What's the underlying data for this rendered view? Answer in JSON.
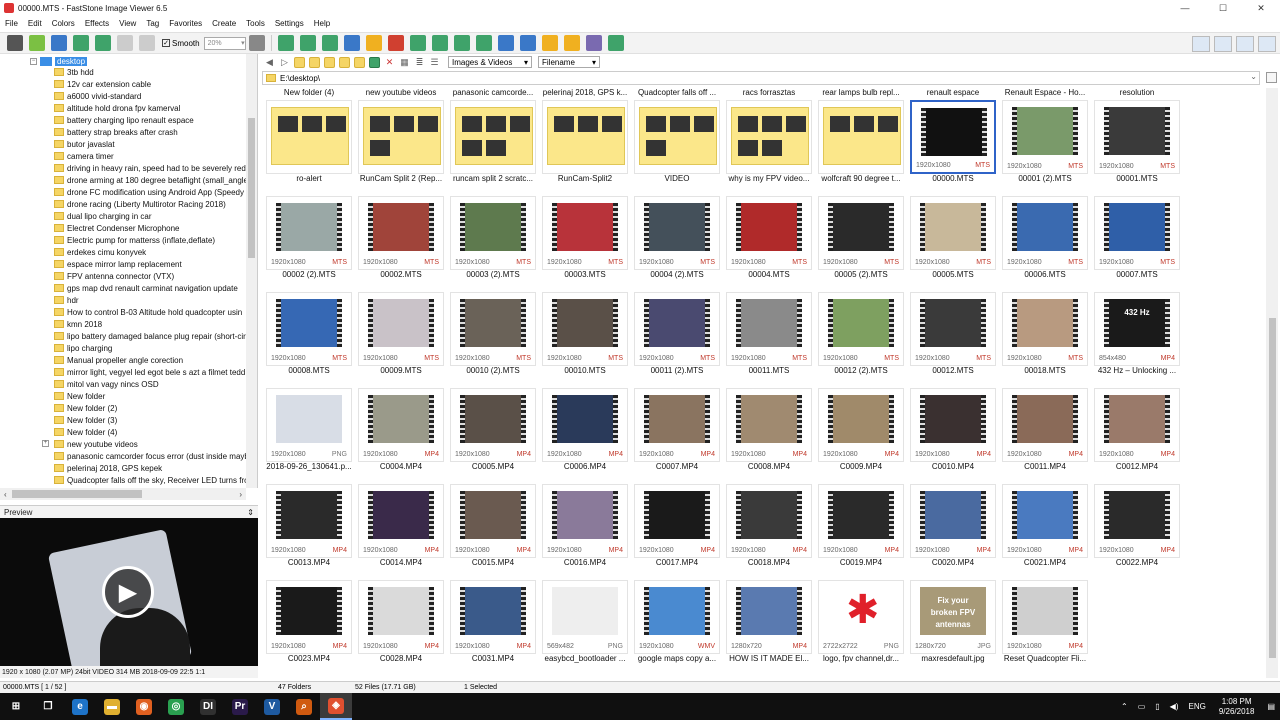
{
  "window": {
    "title": "00000.MTS - FastStone Image Viewer 6.5",
    "controls": [
      "—",
      "☐",
      "✕"
    ]
  },
  "menu": [
    "File",
    "Edit",
    "Colors",
    "Effects",
    "View",
    "Tag",
    "Favorites",
    "Create",
    "Tools",
    "Settings",
    "Help"
  ],
  "toolbar": {
    "smooth_label": "Smooth",
    "smooth_checked": "✓",
    "zoom_value": "20%"
  },
  "tree": {
    "root_label": "desktop",
    "items": [
      "3tb hdd",
      "12v car extension cable",
      "a6000 vivid-standard",
      "altitude hold drona fpv kamerval",
      "battery charging lipo renault espace",
      "battery strap breaks after crash",
      "butor javaslat",
      "camera timer",
      "driving in heavy rain, speed had to be severely redu",
      "drone arming at 180 degree betaflight (small_angle",
      "drone FC modification using Android App (Speedy",
      "drone racing (Liberty Multirotor Racing 2018)",
      "dual lipo charging in car",
      "Electret Condenser Microphone",
      "Electric pump for matterss (inflate,deflate)",
      "erdekes cimu konyvek",
      "espace mirror lamp replacement",
      "FPV antenna connector (VTX)",
      "gps map dvd renault carminat navigation update",
      "hdr",
      "How to control B-03 Altitude hold quadcopter usin",
      "kmn 2018",
      "lipo battery damaged balance plug repair (short-cir",
      "lipo charging",
      "Manual propeller angle corection",
      "mirror light, vegyel led egot bele s azt a filmet tedd",
      "mitol van vagy nincs OSD",
      "New folder",
      "New folder (2)",
      "New folder (3)",
      "New folder (4)",
      "new youtube videos",
      "panasonic camcorder focus error (dust inside mayb",
      "pelerinaj 2018, GPS kepek",
      "Quadcopter falls off the sky, Receiver LED turns fro"
    ]
  },
  "preview": {
    "title": "Preview",
    "pin": "⇕",
    "status": "1920 x 1080 (2.07 MP)  24bit  VIDEO  314 MB  2018-09-09 22:5 1:1"
  },
  "nav": {
    "filter": "Images & Videos",
    "sort": "Filename",
    "path": "E:\\desktop\\"
  },
  "grid_rows": [
    [
      {
        "kind": "folder",
        "top": "New folder (4)",
        "bottom": "ro-alert"
      },
      {
        "kind": "folder",
        "top": "new youtube videos",
        "bottom": "RunCam Split 2 (Rep..."
      },
      {
        "kind": "folder",
        "top": "panasonic camcorde...",
        "bottom": "runcam split 2 scratc..."
      },
      {
        "kind": "folder",
        "top": "pelerinaj 2018, GPS k...",
        "bottom": "RunCam-Split2"
      },
      {
        "kind": "folder",
        "top": "Quadcopter falls off ...",
        "bottom": "VIDEO"
      },
      {
        "kind": "folder",
        "top": "racs forrasztas",
        "bottom": "why is my FPV video..."
      },
      {
        "kind": "folder",
        "top": "rear lamps bulb repl...",
        "bottom": "wolfcraft 90 degree t..."
      },
      {
        "kind": "video",
        "top": "renault espace",
        "res": "1920x1080",
        "ext": "MTS",
        "bottom": "00000.MTS",
        "selected": true,
        "color": "#111111"
      },
      {
        "kind": "video",
        "top": "Renault Espace - Ho...",
        "res": "1920x1080",
        "ext": "MTS",
        "bottom": "00001 (2).MTS",
        "color": "#7a9a6a"
      },
      {
        "kind": "video",
        "top": "resolution",
        "res": "1920x1080",
        "ext": "MTS",
        "bottom": "00001.MTS",
        "color": "#3a3a3a"
      }
    ],
    [
      {
        "kind": "video",
        "res": "1920x1080",
        "ext": "MTS",
        "bottom": "00002 (2).MTS",
        "color": "#9aa8a6"
      },
      {
        "kind": "video",
        "res": "1920x1080",
        "ext": "MTS",
        "bottom": "00002.MTS",
        "color": "#a0443a"
      },
      {
        "kind": "video",
        "res": "1920x1080",
        "ext": "MTS",
        "bottom": "00003 (2).MTS",
        "color": "#5e7a4e"
      },
      {
        "kind": "video",
        "res": "1920x1080",
        "ext": "MTS",
        "bottom": "00003.MTS",
        "color": "#b8333a"
      },
      {
        "kind": "video",
        "res": "1920x1080",
        "ext": "MTS",
        "bottom": "00004 (2).MTS",
        "color": "#44505a"
      },
      {
        "kind": "video",
        "res": "1920x1080",
        "ext": "MTS",
        "bottom": "00004.MTS",
        "color": "#b02a2a"
      },
      {
        "kind": "video",
        "res": "1920x1080",
        "ext": "MTS",
        "bottom": "00005 (2).MTS",
        "color": "#2a2a2a"
      },
      {
        "kind": "video",
        "res": "1920x1080",
        "ext": "MTS",
        "bottom": "00005.MTS",
        "color": "#c8b89a"
      },
      {
        "kind": "video",
        "res": "1920x1080",
        "ext": "MTS",
        "bottom": "00006.MTS",
        "color": "#3a6ab0"
      },
      {
        "kind": "video",
        "res": "1920x1080",
        "ext": "MTS",
        "bottom": "00007.MTS",
        "color": "#2f5fa8"
      }
    ],
    [
      {
        "kind": "video",
        "res": "1920x1080",
        "ext": "MTS",
        "bottom": "00008.MTS",
        "color": "#3668b4"
      },
      {
        "kind": "video",
        "res": "1920x1080",
        "ext": "MTS",
        "bottom": "00009.MTS",
        "color": "#c9c2c8"
      },
      {
        "kind": "video",
        "res": "1920x1080",
        "ext": "MTS",
        "bottom": "00010 (2).MTS",
        "color": "#6a6258"
      },
      {
        "kind": "video",
        "res": "1920x1080",
        "ext": "MTS",
        "bottom": "00010.MTS",
        "color": "#5a5048"
      },
      {
        "kind": "video",
        "res": "1920x1080",
        "ext": "MTS",
        "bottom": "00011 (2).MTS",
        "color": "#4a4a70"
      },
      {
        "kind": "video",
        "res": "1920x1080",
        "ext": "MTS",
        "bottom": "00011.MTS",
        "color": "#8a8a8a"
      },
      {
        "kind": "video",
        "res": "1920x1080",
        "ext": "MTS",
        "bottom": "00012 (2).MTS",
        "color": "#7ea060"
      },
      {
        "kind": "video",
        "res": "1920x1080",
        "ext": "MTS",
        "bottom": "00012.MTS",
        "color": "#3a3a3a"
      },
      {
        "kind": "video",
        "res": "1920x1080",
        "ext": "MTS",
        "bottom": "00018.MTS",
        "color": "#b89a80"
      },
      {
        "kind": "video",
        "res": "854x480",
        "ext": "MP4",
        "bottom": "432 Hz – Unlocking ...",
        "color": "#1a1a1a",
        "overlay": "432 Hz"
      }
    ],
    [
      {
        "kind": "image",
        "res": "1920x1080",
        "ext": "PNG",
        "bottom": "2018-09-26_130641.p...",
        "color": "#d8dde6"
      },
      {
        "kind": "video",
        "res": "1920x1080",
        "ext": "MP4",
        "bottom": "C0004.MP4",
        "color": "#9a9a8a"
      },
      {
        "kind": "video",
        "res": "1920x1080",
        "ext": "MP4",
        "bottom": "C0005.MP4",
        "color": "#5a5048"
      },
      {
        "kind": "video",
        "res": "1920x1080",
        "ext": "MP4",
        "bottom": "C0006.MP4",
        "color": "#2a3a5a"
      },
      {
        "kind": "video",
        "res": "1920x1080",
        "ext": "MP4",
        "bottom": "C0007.MP4",
        "color": "#8a7460"
      },
      {
        "kind": "video",
        "res": "1920x1080",
        "ext": "MP4",
        "bottom": "C0008.MP4",
        "color": "#a08a70"
      },
      {
        "kind": "video",
        "res": "1920x1080",
        "ext": "MP4",
        "bottom": "C0009.MP4",
        "color": "#a08a6a"
      },
      {
        "kind": "video",
        "res": "1920x1080",
        "ext": "MP4",
        "bottom": "C0010.MP4",
        "color": "#3a3030"
      },
      {
        "kind": "video",
        "res": "1920x1080",
        "ext": "MP4",
        "bottom": "C0011.MP4",
        "color": "#8a6a58"
      },
      {
        "kind": "video",
        "res": "1920x1080",
        "ext": "MP4",
        "bottom": "C0012.MP4",
        "color": "#9a7a6a"
      }
    ],
    [
      {
        "kind": "video",
        "res": "1920x1080",
        "ext": "MP4",
        "bottom": "C0013.MP4",
        "color": "#2a2a2a"
      },
      {
        "kind": "video",
        "res": "1920x1080",
        "ext": "MP4",
        "bottom": "C0014.MP4",
        "color": "#3a2a4a"
      },
      {
        "kind": "video",
        "res": "1920x1080",
        "ext": "MP4",
        "bottom": "C0015.MP4",
        "color": "#6a5a50"
      },
      {
        "kind": "video",
        "res": "1920x1080",
        "ext": "MP4",
        "bottom": "C0016.MP4",
        "color": "#8a7a9a"
      },
      {
        "kind": "video",
        "res": "1920x1080",
        "ext": "MP4",
        "bottom": "C0017.MP4",
        "color": "#1a1a1a"
      },
      {
        "kind": "video",
        "res": "1920x1080",
        "ext": "MP4",
        "bottom": "C0018.MP4",
        "color": "#3a3a3a"
      },
      {
        "kind": "video",
        "res": "1920x1080",
        "ext": "MP4",
        "bottom": "C0019.MP4",
        "color": "#2a2a2a"
      },
      {
        "kind": "video",
        "res": "1920x1080",
        "ext": "MP4",
        "bottom": "C0020.MP4",
        "color": "#4a6aa0"
      },
      {
        "kind": "video",
        "res": "1920x1080",
        "ext": "MP4",
        "bottom": "C0021.MP4",
        "color": "#4a7ac0"
      },
      {
        "kind": "video",
        "res": "1920x1080",
        "ext": "MP4",
        "bottom": "C0022.MP4",
        "color": "#2a2a2a"
      }
    ],
    [
      {
        "kind": "video",
        "res": "1920x1080",
        "ext": "MP4",
        "bottom": "C0023.MP4",
        "color": "#1a1a1a"
      },
      {
        "kind": "video",
        "res": "1920x1080",
        "ext": "MP4",
        "bottom": "C0028.MP4",
        "color": "#dadada"
      },
      {
        "kind": "video",
        "res": "1920x1080",
        "ext": "MP4",
        "bottom": "C0031.MP4",
        "color": "#3a5a8a"
      },
      {
        "kind": "image",
        "res": "569x482",
        "ext": "PNG",
        "bottom": "easybcd_bootloader ...",
        "color": "#eeeeee"
      },
      {
        "kind": "video",
        "res": "1920x1080",
        "ext": "WMV",
        "bottom": "google maps copy a...",
        "color": "#4a8ad0"
      },
      {
        "kind": "video",
        "res": "1280x720",
        "ext": "MP4",
        "bottom": "HOW IS IT MADE  El...",
        "color": "#5a7ab0"
      },
      {
        "kind": "image",
        "res": "2722x2722",
        "ext": "PNG",
        "bottom": "logo, fpv channel,dr...",
        "color": "#ffffff",
        "star": true
      },
      {
        "kind": "image",
        "res": "1280x720",
        "ext": "JPG",
        "bottom": "maxresdefault.jpg",
        "color": "#a89a78",
        "overlay": "Fix your broken FPV antennas"
      },
      {
        "kind": "video",
        "res": "1920x1080",
        "ext": "MP4",
        "bottom": "Reset Quadcopter Fli...",
        "color": "#cfcfcf"
      }
    ]
  ],
  "status": {
    "file": "00000.MTS [ 1 / 52 ]",
    "folders": "47 Folders",
    "files": "52 Files (17.71 GB)",
    "selected": "1 Selected"
  },
  "taskbar": {
    "lang": "ENG",
    "time": "1:08 PM",
    "date": "9/26/2018",
    "apps": [
      {
        "name": "start",
        "glyph": "⊞",
        "color": "#101010"
      },
      {
        "name": "task-view",
        "glyph": "❐",
        "color": "#101010"
      },
      {
        "name": "edge",
        "glyph": "e",
        "color": "#1e73c8"
      },
      {
        "name": "file-explorer",
        "glyph": "▬",
        "color": "#e0b030"
      },
      {
        "name": "firefox",
        "glyph": "◉",
        "color": "#e06020"
      },
      {
        "name": "chrome",
        "glyph": "◎",
        "color": "#2aa050"
      },
      {
        "name": "davinci",
        "glyph": "DI",
        "color": "#303030"
      },
      {
        "name": "premiere",
        "glyph": "Pr",
        "color": "#2a1a4a"
      },
      {
        "name": "visual-studio-code",
        "glyph": "V",
        "color": "#1e5aa0"
      },
      {
        "name": "search-tool",
        "glyph": "⌕",
        "color": "#d05a10"
      },
      {
        "name": "faststone",
        "glyph": "◈",
        "color": "#e05030"
      }
    ]
  }
}
